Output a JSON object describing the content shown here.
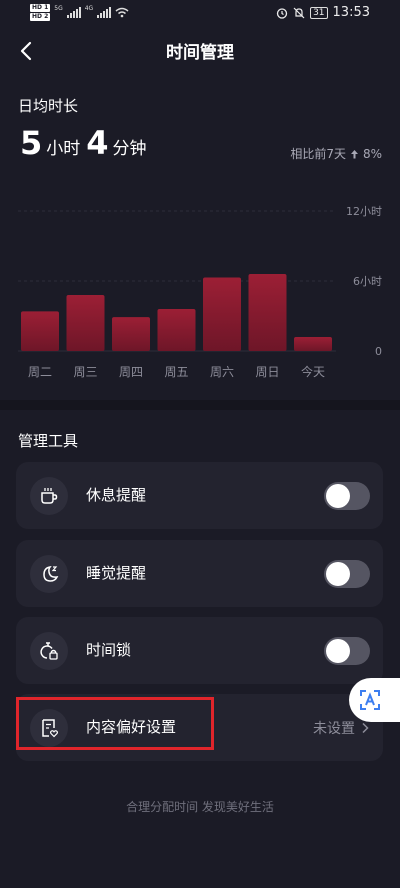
{
  "status_bar": {
    "hd1": "HD 1",
    "hd2": "HD 2",
    "net1": "5G",
    "net2": "4G",
    "battery": "31",
    "time": "13:53"
  },
  "header": {
    "title": "时间管理"
  },
  "summary": {
    "label": "日均时长",
    "hours": "5",
    "hours_unit": "小时",
    "minutes": "4",
    "minutes_unit": "分钟",
    "compare_text": "相比前7天",
    "compare_value": "8%"
  },
  "chart_data": {
    "type": "bar",
    "categories": [
      "周二",
      "周三",
      "周四",
      "周五",
      "周六",
      "周日",
      "今天"
    ],
    "values": [
      3.4,
      4.8,
      2.9,
      3.6,
      6.3,
      6.6,
      1.2
    ],
    "ylim": [
      0,
      12
    ],
    "yticks": [
      {
        "v": 0,
        "label": "0"
      },
      {
        "v": 6,
        "label": "6小时"
      },
      {
        "v": 12,
        "label": "12小时"
      }
    ],
    "bar_color_top": "#9c1f35",
    "bar_color_bottom": "#6e1628",
    "grid": true
  },
  "tools": {
    "section_title": "管理工具",
    "items": [
      {
        "label": "休息提醒",
        "icon": "cup-icon",
        "toggle": false
      },
      {
        "label": "睡觉提醒",
        "icon": "moon-icon",
        "toggle": false
      },
      {
        "label": "时间锁",
        "icon": "timer-lock-icon",
        "toggle": false
      }
    ],
    "content_pref": {
      "label": "内容偏好设置",
      "icon": "content-preference-icon",
      "value": "未设置"
    }
  },
  "footer": {
    "text": "合理分配时间 发现美好生活"
  },
  "colors": {
    "background": "#1b1b26",
    "card": "#23232f",
    "highlight": "#e0252b"
  }
}
